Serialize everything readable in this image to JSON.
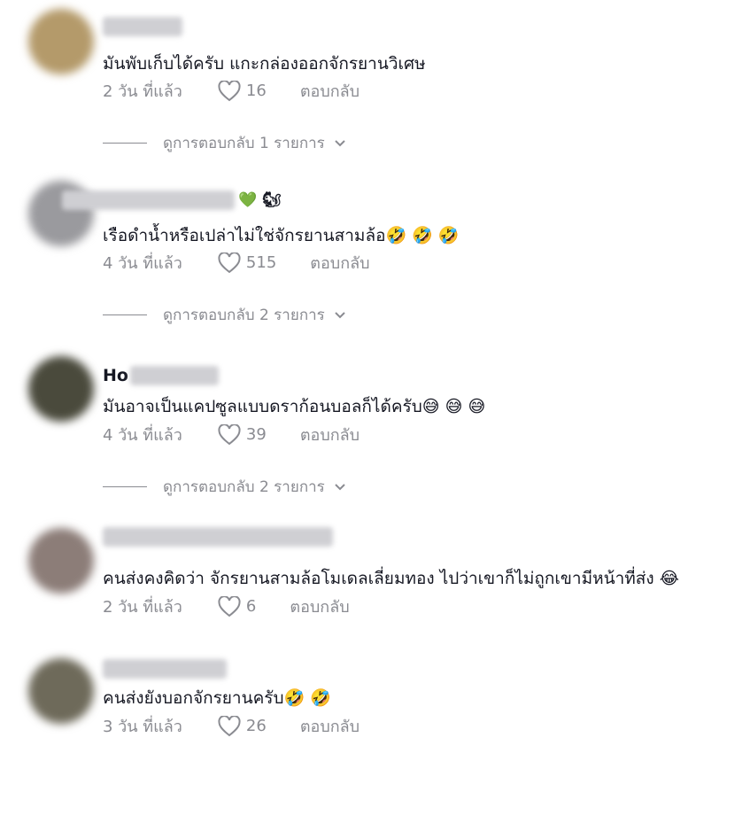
{
  "comments": [
    {
      "text": "มันพับเก็บได้ครับ แกะกล่องออกจักรยานวิเศษ",
      "time": "2 วัน ที่แล้ว",
      "likes": "16",
      "reply_label": "ตอบกลับ",
      "view_replies": "ดูการตอบกลับ 1 รายการ",
      "avatar_color": "#b49a6a"
    },
    {
      "username_emojis": "💚 🐿",
      "text": "เรือดำน้ำหรือเปล่าไม่ใช่จักรยานสามล้อ🤣 🤣 🤣",
      "time": "4 วัน ที่แล้ว",
      "likes": "515",
      "reply_label": "ตอบกลับ",
      "view_replies": "ดูการตอบกลับ 2 รายการ",
      "avatar_color": "#9a9a9e"
    },
    {
      "username": "Ho",
      "text": "มันอาจเป็นแคปซูลแบบดราก้อนบอลก็ได้ครับ😅 😅 😅",
      "time": "4 วัน ที่แล้ว",
      "likes": "39",
      "reply_label": "ตอบกลับ",
      "view_replies": "ดูการตอบกลับ 2 รายการ",
      "avatar_color": "#4a4a3c"
    },
    {
      "text": "คนส่งคงคิดว่า จักรยานสามล้อโมเดลเลี่ยมทอง ไปว่าเขาก็ไม่ถูกเขามีหน้าที่ส่ง 😂",
      "time": "2 วัน ที่แล้ว",
      "likes": "6",
      "reply_label": "ตอบกลับ",
      "avatar_color": "#8c7d78"
    },
    {
      "text": "คนส่งยังบอกจักรยานครับ🤣 🤣",
      "time": "3 วัน ที่แล้ว",
      "likes": "26",
      "reply_label": "ตอบกลับ",
      "avatar_color": "#6e6a5a"
    }
  ]
}
